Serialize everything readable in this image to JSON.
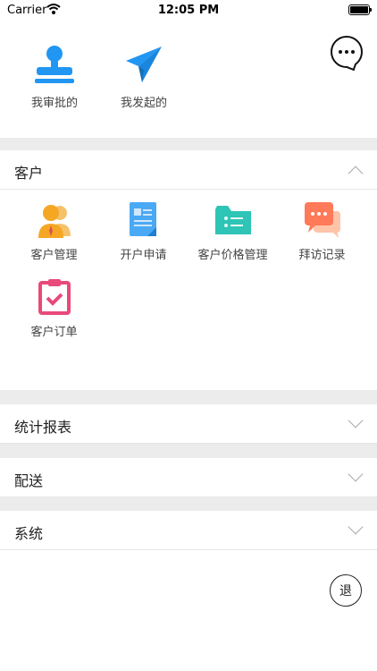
{
  "status_bar": {
    "carrier": "Carrier",
    "time": "12:05 PM"
  },
  "quick_actions": {
    "approve_label": "我审批的",
    "initiated_label": "我发起的"
  },
  "sections": {
    "customer": {
      "title": "客户",
      "items": [
        {
          "label": "客户管理",
          "icon": "customers-icon"
        },
        {
          "label": "开户申请",
          "icon": "document-icon"
        },
        {
          "label": "客户价格管理",
          "icon": "folder-list-icon"
        },
        {
          "label": "拜访记录",
          "icon": "chat-bubbles-icon"
        },
        {
          "label": "客户订单",
          "icon": "clipboard-check-icon"
        }
      ]
    },
    "stats": {
      "title": "统计报表"
    },
    "delivery": {
      "title": "配送"
    },
    "system": {
      "title": "系统"
    }
  },
  "logout_label": "退",
  "colors": {
    "blue": "#2196f3",
    "orange": "#f5a623",
    "teal": "#2ec4b6",
    "coral": "#ff7a59",
    "pink": "#e84a7a",
    "separator": "#ececec"
  }
}
